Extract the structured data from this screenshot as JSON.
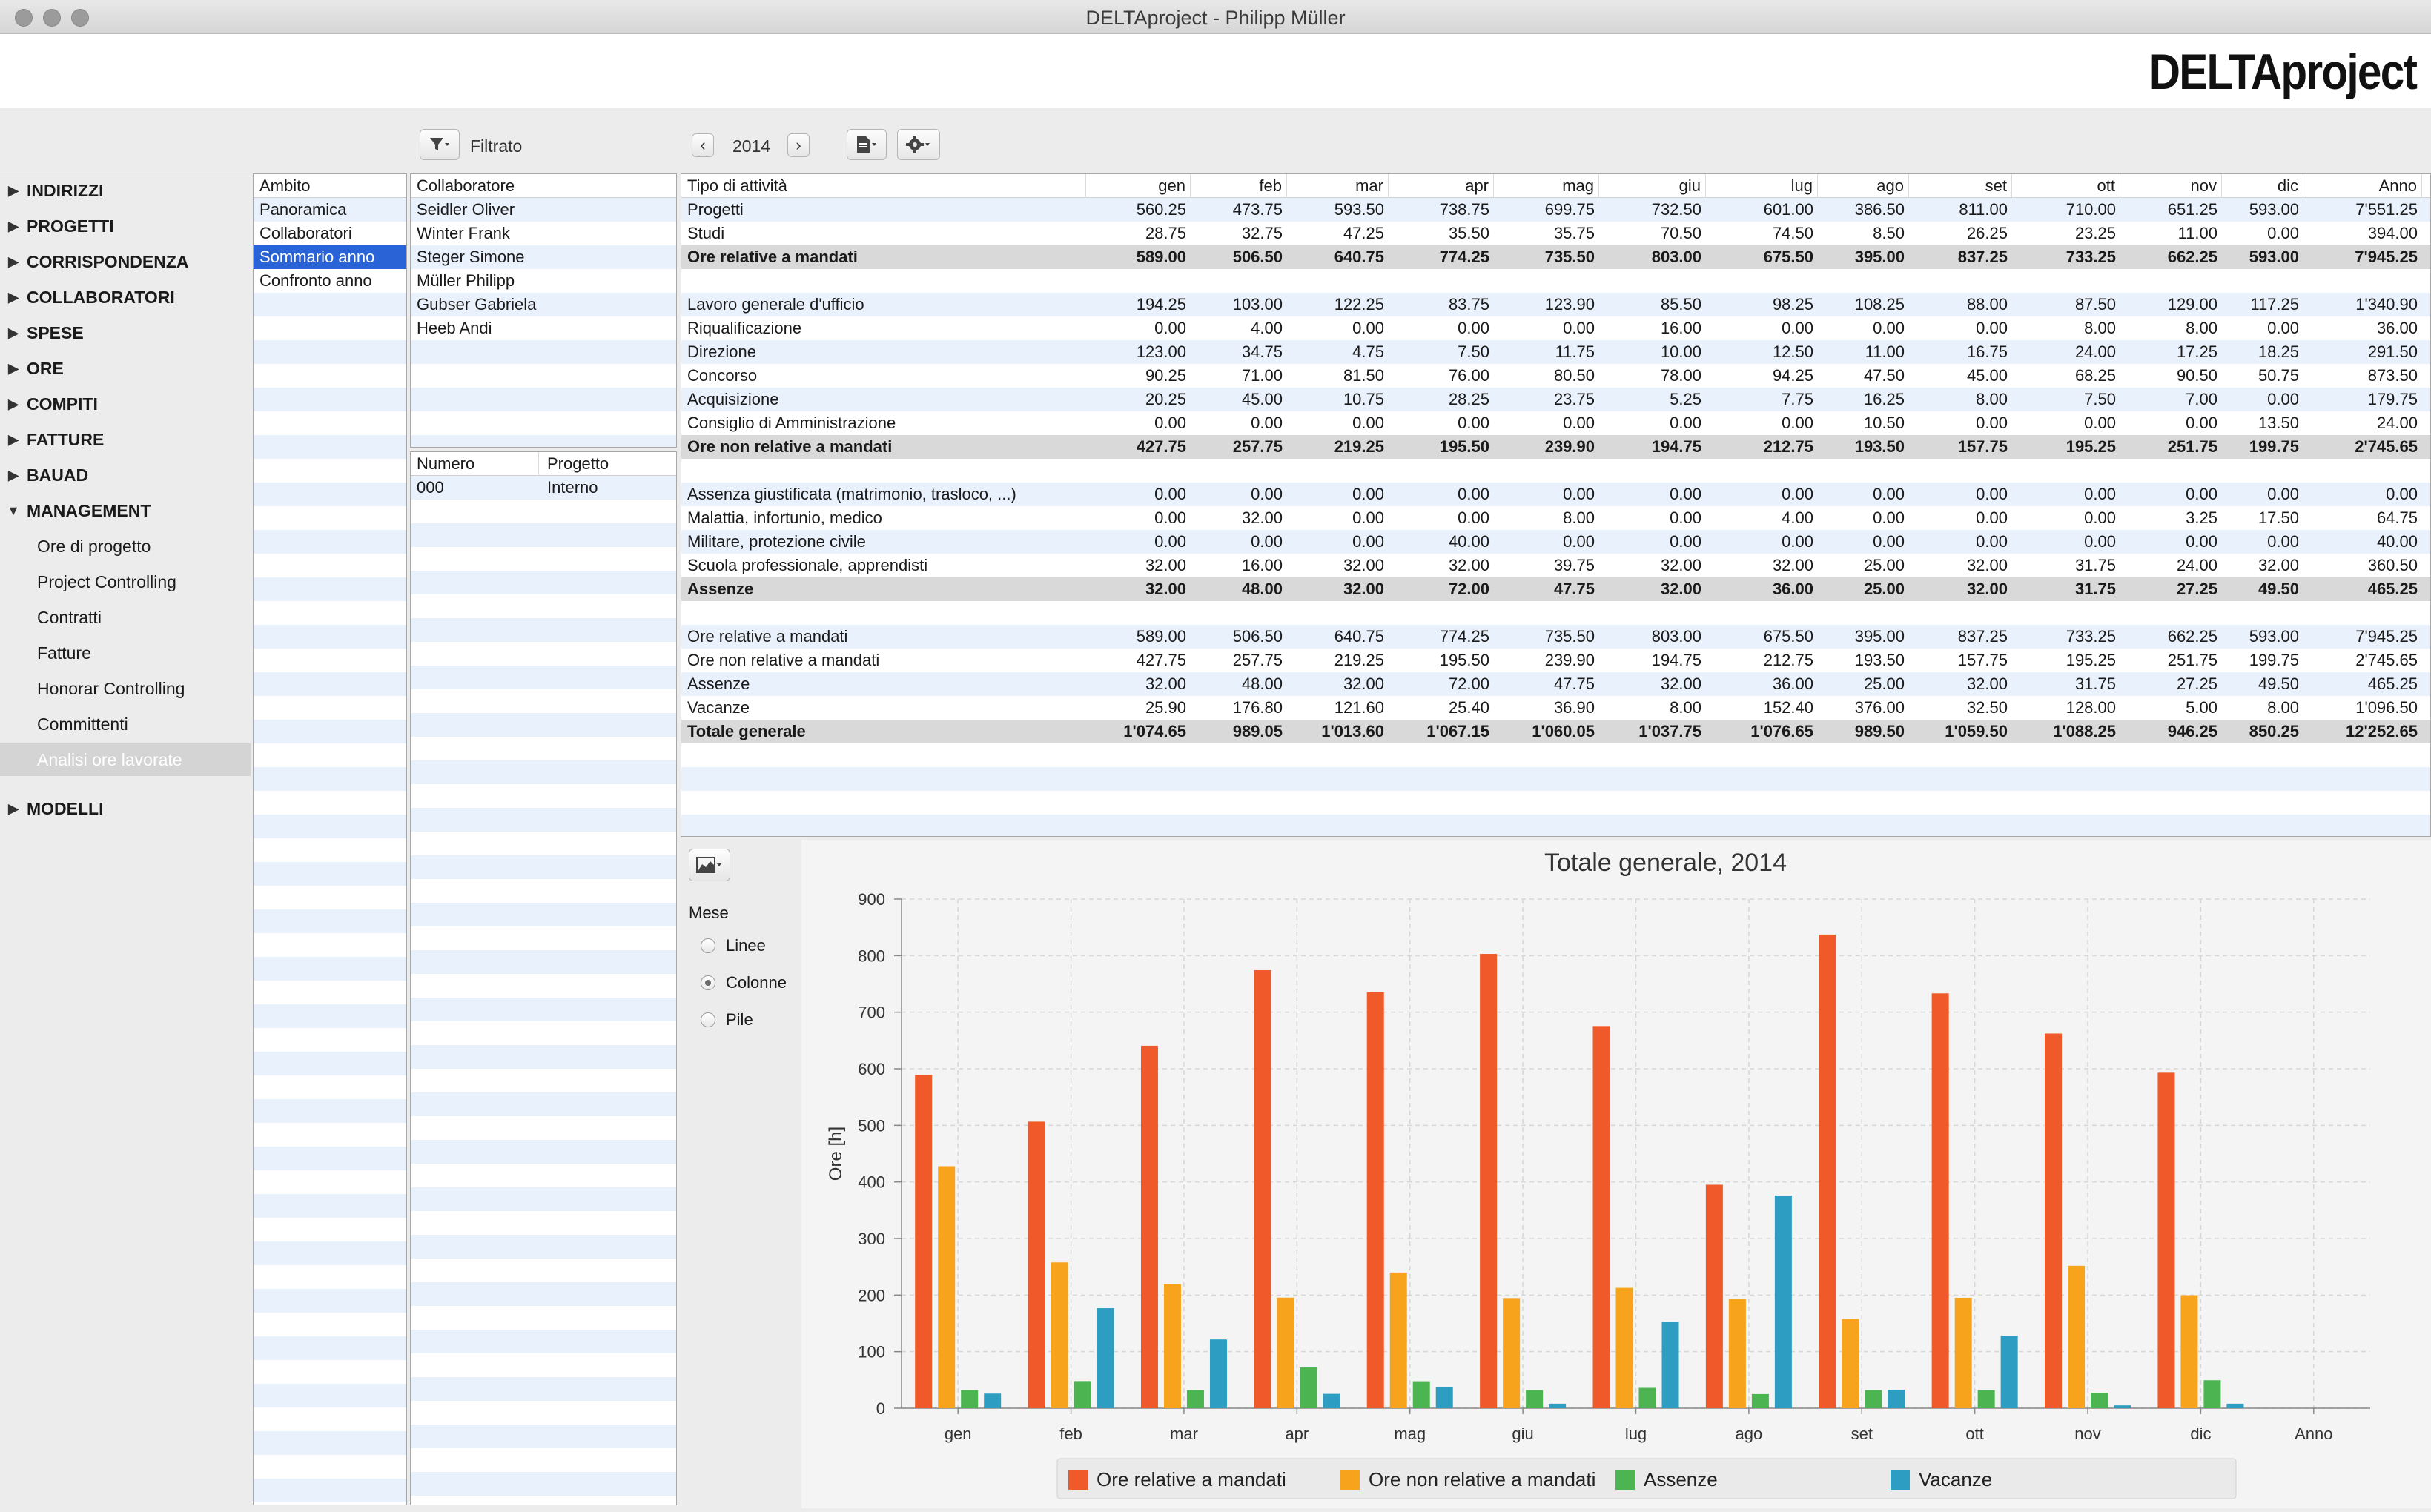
{
  "window": {
    "title": "DELTAproject - Philipp Müller"
  },
  "header": {
    "logo": "DELTAproject"
  },
  "toolbar": {
    "filter_label": "Filtrato",
    "year": "2014"
  },
  "sidebar": {
    "items": [
      {
        "label": "INDIRIZZI"
      },
      {
        "label": "PROGETTI"
      },
      {
        "label": "CORRISPONDENZA"
      },
      {
        "label": "COLLABORATORI"
      },
      {
        "label": "SPESE"
      },
      {
        "label": "ORE"
      },
      {
        "label": "COMPITI"
      },
      {
        "label": "FATTURE"
      },
      {
        "label": "BAUAD"
      },
      {
        "label": "MANAGEMENT"
      }
    ],
    "management_sub": [
      {
        "label": "Ore di progetto"
      },
      {
        "label": "Project Controlling"
      },
      {
        "label": "Contratti"
      },
      {
        "label": "Fatture"
      },
      {
        "label": "Honorar Controlling"
      },
      {
        "label": "Committenti"
      },
      {
        "label": "Analisi ore lavorate"
      }
    ],
    "last": {
      "label": "MODELLI"
    }
  },
  "ambito": {
    "header": "Ambito",
    "items": [
      {
        "label": "Panoramica"
      },
      {
        "label": "Collaboratori"
      },
      {
        "label": "Sommario anno"
      },
      {
        "label": "Confronto anno"
      }
    ]
  },
  "collaboratori": {
    "header": "Collaboratore",
    "items": [
      {
        "label": "Seidler Oliver"
      },
      {
        "label": "Winter Frank"
      },
      {
        "label": "Steger Simone"
      },
      {
        "label": "Müller Philipp"
      },
      {
        "label": "Gubser Gabriela"
      },
      {
        "label": "Heeb Andi"
      }
    ]
  },
  "progetti": {
    "header_num": "Numero",
    "header_proj": "Progetto",
    "rows": [
      {
        "num": "000",
        "proj": "Interno"
      }
    ]
  },
  "table": {
    "headers": [
      "Tipo di attività",
      "gen",
      "feb",
      "mar",
      "apr",
      "mag",
      "giu",
      "lug",
      "ago",
      "set",
      "ott",
      "nov",
      "dic",
      "Anno"
    ],
    "rows": [
      {
        "label": "Progetti",
        "vals": [
          "560.25",
          "473.75",
          "593.50",
          "738.75",
          "699.75",
          "732.50",
          "601.00",
          "386.50",
          "811.00",
          "710.00",
          "651.25",
          "593.00",
          "7'551.25"
        ]
      },
      {
        "label": "Studi",
        "vals": [
          "28.75",
          "32.75",
          "47.25",
          "35.50",
          "35.75",
          "70.50",
          "74.50",
          "8.50",
          "26.25",
          "23.25",
          "11.00",
          "0.00",
          "394.00"
        ]
      },
      {
        "label": "Ore relative a mandati",
        "total": true,
        "vals": [
          "589.00",
          "506.50",
          "640.75",
          "774.25",
          "735.50",
          "803.00",
          "675.50",
          "395.00",
          "837.25",
          "733.25",
          "662.25",
          "593.00",
          "7'945.25"
        ]
      },
      {
        "label": "",
        "vals": [
          "",
          "",
          "",
          "",
          "",
          "",
          "",
          "",
          "",
          "",
          "",
          "",
          ""
        ]
      },
      {
        "label": "Lavoro generale d'ufficio",
        "vals": [
          "194.25",
          "103.00",
          "122.25",
          "83.75",
          "123.90",
          "85.50",
          "98.25",
          "108.25",
          "88.00",
          "87.50",
          "129.00",
          "117.25",
          "1'340.90"
        ]
      },
      {
        "label": "Riqualificazione",
        "vals": [
          "0.00",
          "4.00",
          "0.00",
          "0.00",
          "0.00",
          "16.00",
          "0.00",
          "0.00",
          "0.00",
          "8.00",
          "8.00",
          "0.00",
          "36.00"
        ]
      },
      {
        "label": "Direzione",
        "vals": [
          "123.00",
          "34.75",
          "4.75",
          "7.50",
          "11.75",
          "10.00",
          "12.50",
          "11.00",
          "16.75",
          "24.00",
          "17.25",
          "18.25",
          "291.50"
        ]
      },
      {
        "label": "Concorso",
        "vals": [
          "90.25",
          "71.00",
          "81.50",
          "76.00",
          "80.50",
          "78.00",
          "94.25",
          "47.50",
          "45.00",
          "68.25",
          "90.50",
          "50.75",
          "873.50"
        ]
      },
      {
        "label": "Acquisizione",
        "vals": [
          "20.25",
          "45.00",
          "10.75",
          "28.25",
          "23.75",
          "5.25",
          "7.75",
          "16.25",
          "8.00",
          "7.50",
          "7.00",
          "0.00",
          "179.75"
        ]
      },
      {
        "label": "Consiglio di Amministrazione",
        "vals": [
          "0.00",
          "0.00",
          "0.00",
          "0.00",
          "0.00",
          "0.00",
          "0.00",
          "10.50",
          "0.00",
          "0.00",
          "0.00",
          "13.50",
          "24.00"
        ]
      },
      {
        "label": "Ore non relative a mandati",
        "total": true,
        "vals": [
          "427.75",
          "257.75",
          "219.25",
          "195.50",
          "239.90",
          "194.75",
          "212.75",
          "193.50",
          "157.75",
          "195.25",
          "251.75",
          "199.75",
          "2'745.65"
        ]
      },
      {
        "label": "",
        "vals": [
          "",
          "",
          "",
          "",
          "",
          "",
          "",
          "",
          "",
          "",
          "",
          "",
          ""
        ]
      },
      {
        "label": "Assenza giustificata (matrimonio, trasloco, ...)",
        "vals": [
          "0.00",
          "0.00",
          "0.00",
          "0.00",
          "0.00",
          "0.00",
          "0.00",
          "0.00",
          "0.00",
          "0.00",
          "0.00",
          "0.00",
          "0.00"
        ]
      },
      {
        "label": "Malattia, infortunio, medico",
        "vals": [
          "0.00",
          "32.00",
          "0.00",
          "0.00",
          "8.00",
          "0.00",
          "4.00",
          "0.00",
          "0.00",
          "0.00",
          "3.25",
          "17.50",
          "64.75"
        ]
      },
      {
        "label": "Militare, protezione civile",
        "vals": [
          "0.00",
          "0.00",
          "0.00",
          "40.00",
          "0.00",
          "0.00",
          "0.00",
          "0.00",
          "0.00",
          "0.00",
          "0.00",
          "0.00",
          "40.00"
        ]
      },
      {
        "label": "Scuola professionale, apprendisti",
        "vals": [
          "32.00",
          "16.00",
          "32.00",
          "32.00",
          "39.75",
          "32.00",
          "32.00",
          "25.00",
          "32.00",
          "31.75",
          "24.00",
          "32.00",
          "360.50"
        ]
      },
      {
        "label": "Assenze",
        "total": true,
        "vals": [
          "32.00",
          "48.00",
          "32.00",
          "72.00",
          "47.75",
          "32.00",
          "36.00",
          "25.00",
          "32.00",
          "31.75",
          "27.25",
          "49.50",
          "465.25"
        ]
      },
      {
        "label": "",
        "vals": [
          "",
          "",
          "",
          "",
          "",
          "",
          "",
          "",
          "",
          "",
          "",
          "",
          ""
        ]
      },
      {
        "label": "Ore relative a mandati",
        "vals": [
          "589.00",
          "506.50",
          "640.75",
          "774.25",
          "735.50",
          "803.00",
          "675.50",
          "395.00",
          "837.25",
          "733.25",
          "662.25",
          "593.00",
          "7'945.25"
        ]
      },
      {
        "label": "Ore non relative a mandati",
        "vals": [
          "427.75",
          "257.75",
          "219.25",
          "195.50",
          "239.90",
          "194.75",
          "212.75",
          "193.50",
          "157.75",
          "195.25",
          "251.75",
          "199.75",
          "2'745.65"
        ]
      },
      {
        "label": "Assenze",
        "vals": [
          "32.00",
          "48.00",
          "32.00",
          "72.00",
          "47.75",
          "32.00",
          "36.00",
          "25.00",
          "32.00",
          "31.75",
          "27.25",
          "49.50",
          "465.25"
        ]
      },
      {
        "label": "Vacanze",
        "vals": [
          "25.90",
          "176.80",
          "121.60",
          "25.40",
          "36.90",
          "8.00",
          "152.40",
          "376.00",
          "32.50",
          "128.00",
          "5.00",
          "8.00",
          "1'096.50"
        ]
      },
      {
        "label": "Totale generale",
        "total": true,
        "vals": [
          "1'074.65",
          "989.05",
          "1'013.60",
          "1'067.15",
          "1'060.05",
          "1'037.75",
          "1'076.65",
          "989.50",
          "1'059.50",
          "1'088.25",
          "946.25",
          "850.25",
          "12'252.65"
        ]
      }
    ]
  },
  "chart_options": {
    "section_label": "Mese",
    "options": [
      {
        "label": "Linee",
        "selected": false
      },
      {
        "label": "Colonne",
        "selected": true
      },
      {
        "label": "Pile",
        "selected": false
      }
    ]
  },
  "chart_data": {
    "type": "bar",
    "title": "Totale generale, 2014",
    "xlabel": "",
    "ylabel": "Ore [h]",
    "ylim": [
      0,
      900
    ],
    "yticks": [
      0,
      100,
      200,
      300,
      400,
      500,
      600,
      700,
      800,
      900
    ],
    "grid": true,
    "legend_position": "bottom",
    "categories": [
      "gen",
      "feb",
      "mar",
      "apr",
      "mag",
      "giu",
      "lug",
      "ago",
      "set",
      "ott",
      "nov",
      "dic",
      "Anno"
    ],
    "series": [
      {
        "name": "Ore relative a mandati",
        "color": "#f05a2a",
        "values": [
          589.0,
          506.5,
          640.75,
          774.25,
          735.5,
          803.0,
          675.5,
          395.0,
          837.25,
          733.25,
          662.25,
          593.0,
          null
        ]
      },
      {
        "name": "Ore non relative a mandati",
        "color": "#f8a31c",
        "values": [
          427.75,
          257.75,
          219.25,
          195.5,
          239.9,
          194.75,
          212.75,
          193.5,
          157.75,
          195.25,
          251.75,
          199.75,
          null
        ]
      },
      {
        "name": "Assenze",
        "color": "#4cb551",
        "values": [
          32.0,
          48.0,
          32.0,
          72.0,
          47.75,
          32.0,
          36.0,
          25.0,
          32.0,
          31.75,
          27.25,
          49.5,
          null
        ]
      },
      {
        "name": "Vacanze",
        "color": "#2d9ec2",
        "values": [
          25.9,
          176.8,
          121.6,
          25.4,
          36.9,
          8.0,
          152.4,
          376.0,
          32.5,
          128.0,
          5.0,
          8.0,
          null
        ]
      }
    ]
  }
}
